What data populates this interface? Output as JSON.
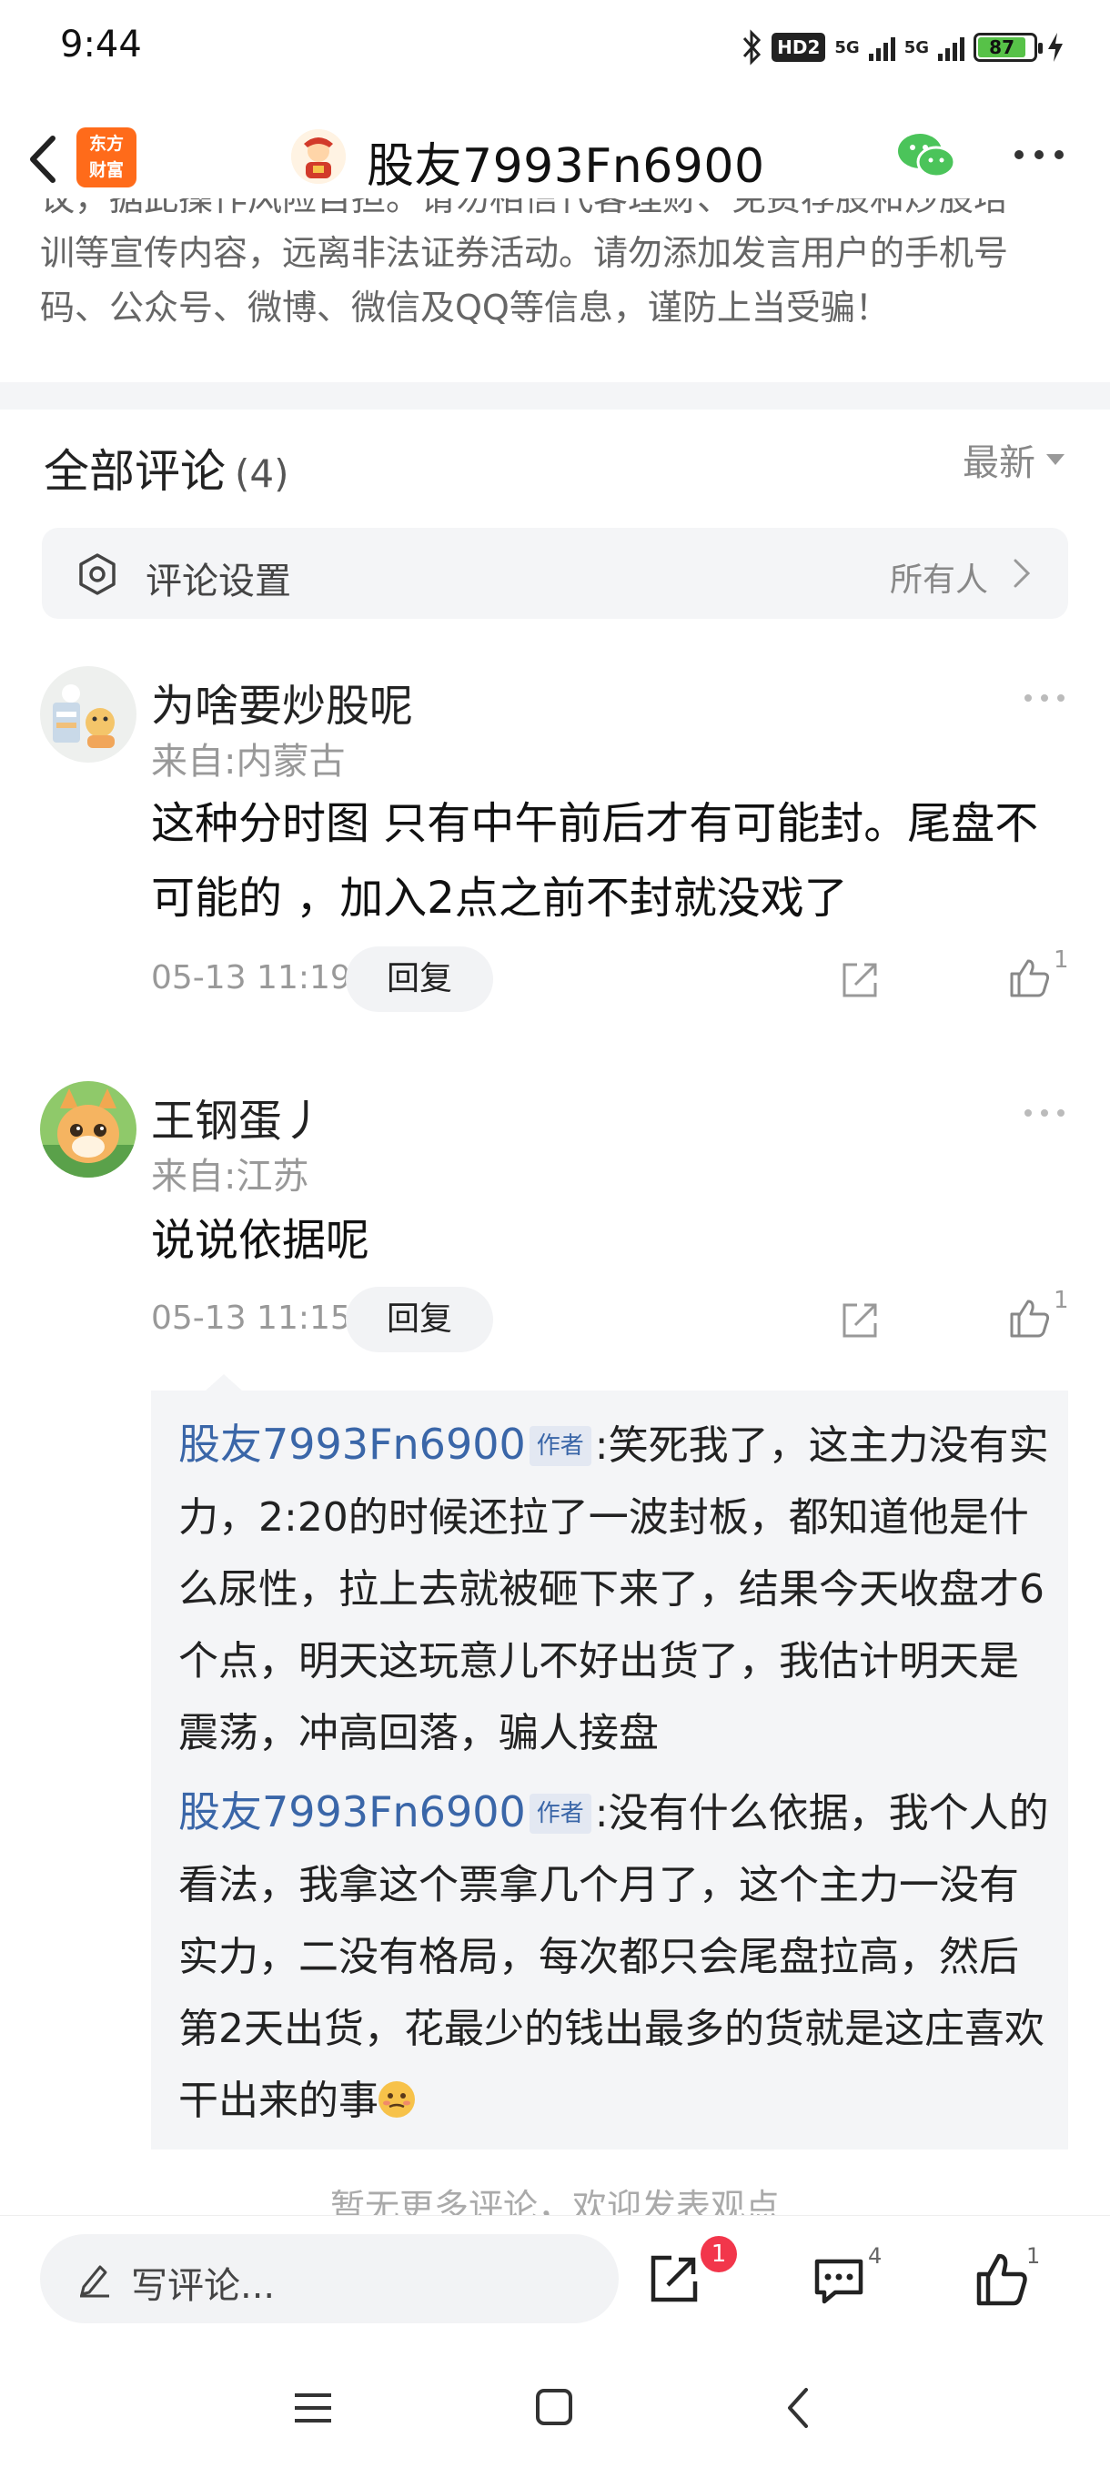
{
  "status_bar": {
    "time": "9:44",
    "hd_label": "HD2",
    "net1": "5G",
    "net2": "5G",
    "battery": "87",
    "battery_level": 0.87
  },
  "nav": {
    "app_logo_line1": "东方",
    "app_logo_line2": "财富",
    "title": "股友7993Fn6900"
  },
  "disclaimer": {
    "line1": "议，据此操作风险自担。请勿相信代客理财、免费荐股和炒股培",
    "line2": "训等宣传内容，远离非法证券活动。请勿添加发言用户的手机号",
    "line3": "码、公众号、微博、微信及QQ等信息，谨防上当受骗！"
  },
  "comments_header": {
    "title": "全部评论",
    "count": "(4)",
    "sort_label": "最新"
  },
  "settings": {
    "label": "评论设置",
    "value": "所有人"
  },
  "comments": [
    {
      "name": "为啥要炒股呢",
      "from": "来自:内蒙古",
      "text": "这种分时图 只有中午前后才有可能封。尾盘不可能的 ，加入2点之前不封就没戏了",
      "time": "05-13 11:19",
      "reply_label": "回复",
      "likes": "1"
    },
    {
      "name": "王钢蛋丿",
      "from": "来自:江苏",
      "text": "说说依据呢",
      "time": "05-13 11:15",
      "reply_label": "回复",
      "likes": "1"
    }
  ],
  "replies": [
    {
      "name": "股友7993Fn6900",
      "tag": "作者",
      "text": ":笑死我了，这主力没有实力，2:20的时候还拉了一波封板，都知道他是什么尿性，拉上去就被砸下来了，结果今天收盘才6个点，明天这玩意儿不好出货了，我估计明天是震荡，冲高回落，骗人接盘"
    },
    {
      "name": "股友7993Fn6900",
      "tag": "作者",
      "text": ":没有什么依据，我个人的看法，我拿这个票拿几个月了，这个主力一没有实力，二没有格局，每次都只会尾盘拉高，然后第2天出货，花最少的钱出最多的货就是这庄喜欢干出来的事"
    }
  ],
  "more_hint": "暂无更多评论，欢迎发表观点",
  "bottom_bar": {
    "input_placeholder": "写评论...",
    "share_badge": "1",
    "comment_count": "4",
    "like_count": "1"
  },
  "colors": {
    "author_blue": "#3a66a8",
    "logo_orange": "#ff6b1a",
    "badge_red": "#f2364b",
    "wechat_green": "#4bc45a"
  }
}
